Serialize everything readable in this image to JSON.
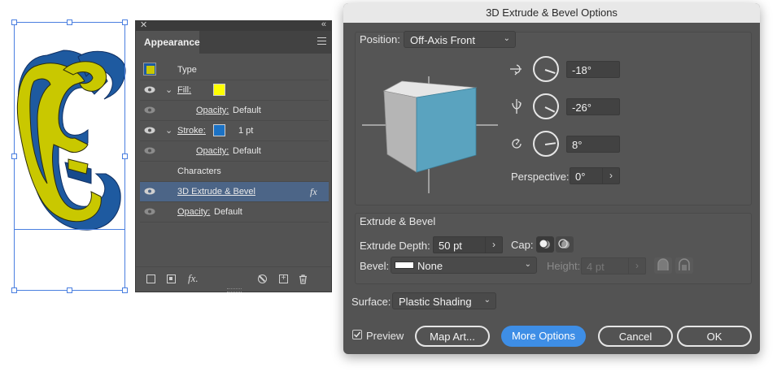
{
  "appearance": {
    "title": "Appearance",
    "rows": [
      {
        "label": "Type"
      },
      {
        "label": "Fill:",
        "swatch_color": "#ffff00"
      },
      {
        "label": "Opacity:",
        "value": "Default"
      },
      {
        "label": "Stroke:",
        "swatch_color": "#1c72c4",
        "value": "1 pt"
      },
      {
        "label": "Opacity:",
        "value": "Default"
      },
      {
        "label": "Characters"
      },
      {
        "label": "3D Extrude & Bevel",
        "fx": "fx"
      },
      {
        "label": "Opacity:",
        "value": "Default"
      }
    ],
    "bottom_fx": "fx."
  },
  "dialog": {
    "title": "3D Extrude & Bevel Options",
    "position": {
      "label": "Position:",
      "value": "Off-Axis Front"
    },
    "rotation": {
      "x": "-18°",
      "y": "-26°",
      "z": "8°"
    },
    "perspective": {
      "label": "Perspective:",
      "value": "0°"
    },
    "extrude_section": {
      "title": "Extrude & Bevel"
    },
    "extrude_depth": {
      "label": "Extrude Depth:",
      "value": "50 pt"
    },
    "cap": {
      "label": "Cap:"
    },
    "bevel": {
      "label": "Bevel:",
      "value": "None"
    },
    "height": {
      "label": "Height:",
      "value": "4 pt"
    },
    "surface": {
      "label": "Surface:",
      "value": "Plastic Shading"
    },
    "preview": {
      "label": "Preview",
      "checked": true
    },
    "buttons": {
      "map_art": "Map Art...",
      "more_options": "More Options",
      "cancel": "Cancel",
      "ok": "OK"
    }
  },
  "colors": {
    "panel_bg": "#535353",
    "selection": "#4c6587",
    "accent_blue": "#3e8ee6",
    "cube_front": "#5aa3bf",
    "art_fill": "#c9c800",
    "art_extrude": "#1e5aa0"
  }
}
